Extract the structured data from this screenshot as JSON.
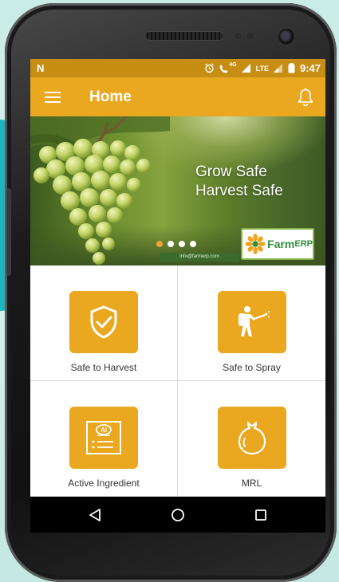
{
  "status_bar": {
    "carrier_glyph": "N",
    "network_type": "4G",
    "lte_label": "LTE",
    "battery_text": "",
    "time": "9:47",
    "icons": [
      "alarm-icon",
      "call-icon",
      "signal-icon",
      "battery-icon"
    ]
  },
  "app_bar": {
    "title": "Home",
    "left_icon": "menu-icon",
    "right_icon": "bell-icon",
    "color": "#e9a81f",
    "status_color": "#c78e14"
  },
  "banner": {
    "headline_line1": "Grow Safe",
    "headline_line2": "Harvest Safe",
    "email": "info@farmerp.com",
    "logo_text_farm": "Farm",
    "logo_text_erp": "ERP",
    "carousel_dots": 4,
    "active_dot": 0
  },
  "tiles": [
    {
      "label": "Safe to Harvest",
      "icon": "shield-check-icon"
    },
    {
      "label": "Safe to Spray",
      "icon": "sprayer-person-icon"
    },
    {
      "label": "Active Ingredient",
      "icon": "active-ingredient-certificate-icon",
      "icon_text": "AI"
    },
    {
      "label": "MRL",
      "icon": "fruit-icon"
    }
  ],
  "nav_bar": {
    "icons": [
      "back-icon",
      "home-icon",
      "recents-icon"
    ]
  }
}
